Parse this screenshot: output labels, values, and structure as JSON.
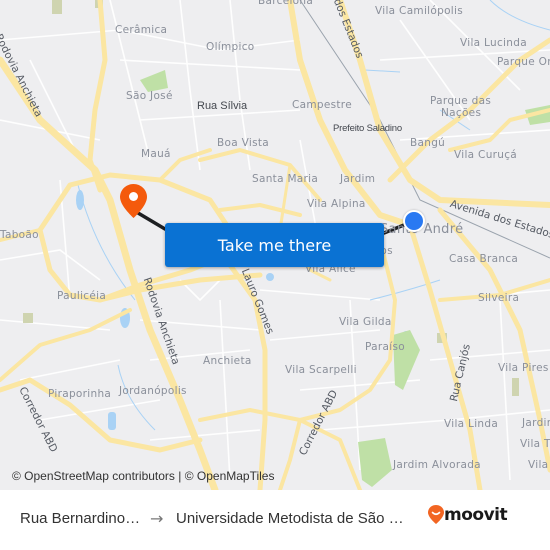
{
  "map": {
    "neighborhood_labels": [
      {
        "text": "Barcelona"
      },
      {
        "text": "Vila Camilópolis"
      },
      {
        "text": "Cerâmica"
      },
      {
        "text": "Olímpico"
      },
      {
        "text": "Vila Lucinda"
      },
      {
        "text": "Parque Oratório"
      },
      {
        "text": "São José"
      },
      {
        "text": "Campestre"
      },
      {
        "text": "Parque das"
      },
      {
        "text": "Nações"
      },
      {
        "text": "Boa Vista"
      },
      {
        "text": "Bangú"
      },
      {
        "text": "Mauá"
      },
      {
        "text": "Vila Curuçá"
      },
      {
        "text": "Santa Maria"
      },
      {
        "text": "Jardim"
      },
      {
        "text": "Vila Alpina"
      },
      {
        "text": "Taboão"
      },
      {
        "text": "Santo André"
      },
      {
        "text": "Bastos"
      },
      {
        "text": "Casa Branca"
      },
      {
        "text": "Vila Alice"
      },
      {
        "text": "Paulicéia"
      },
      {
        "text": "Silveira"
      },
      {
        "text": "Vila Gilda"
      },
      {
        "text": "Paraíso"
      },
      {
        "text": "Anchieta"
      },
      {
        "text": "Vila Scarpelli"
      },
      {
        "text": "Vila Pires"
      },
      {
        "text": "Piraporinha"
      },
      {
        "text": "Jordanópolis"
      },
      {
        "text": "Vila Linda"
      },
      {
        "text": "Jardim"
      },
      {
        "text": "Vila T"
      },
      {
        "text": "Jardim Alvorada"
      },
      {
        "text": "Vila"
      }
    ],
    "road_labels": [
      {
        "text": "Rodovia Anchieta"
      },
      {
        "text": "Avenida dos Estados"
      },
      {
        "text": "Avenida dos Estados"
      },
      {
        "text": "Rodovia Anchieta"
      },
      {
        "text": "Lauro Gomes"
      },
      {
        "text": "Corredor ABD"
      },
      {
        "text": "Corredor ABD"
      },
      {
        "text": "Rua Canjós"
      }
    ],
    "poi_labels": [
      {
        "text": "Rua Sílvia"
      },
      {
        "text": "Prefeito Saladino"
      }
    ],
    "origin_marker": {
      "type": "current-location-dot",
      "color": "#2979f2"
    },
    "destination_marker": {
      "type": "pin",
      "color": "#f45a0c"
    },
    "route_line_color": "#1d1f22",
    "colors": {
      "background": "#eeeef0",
      "major_road": "#fbe6a2",
      "park": "#bfe0a6",
      "water": "#a9d2f5"
    }
  },
  "cta_button": {
    "label": "Take me there",
    "color": "#0a72d3"
  },
  "attribution": "© OpenStreetMap contributors | © OpenMapTiles",
  "footer": {
    "origin": "Rua Bernardino…",
    "arrow_icon": "→",
    "destination": "Universidade Metodista de São …",
    "brand": "moovit",
    "brand_color": "#f26522"
  }
}
